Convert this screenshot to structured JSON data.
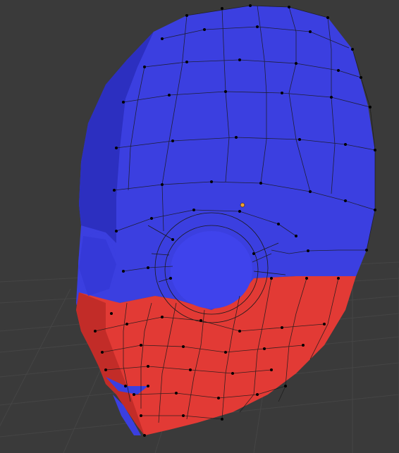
{
  "viewport": {
    "mode": "edit-mesh",
    "object": "head-mesh",
    "colors": {
      "background": "#3a3a3a",
      "grid_line": "#454545",
      "upper_material": "#3b3fe0",
      "upper_shadow": "#2c2fc0",
      "lower_material": "#e23a35",
      "lower_shadow": "#c22c28",
      "wire": "#1a1a1a",
      "vertex": "#000000",
      "origin_dot": "#f0a030"
    }
  }
}
